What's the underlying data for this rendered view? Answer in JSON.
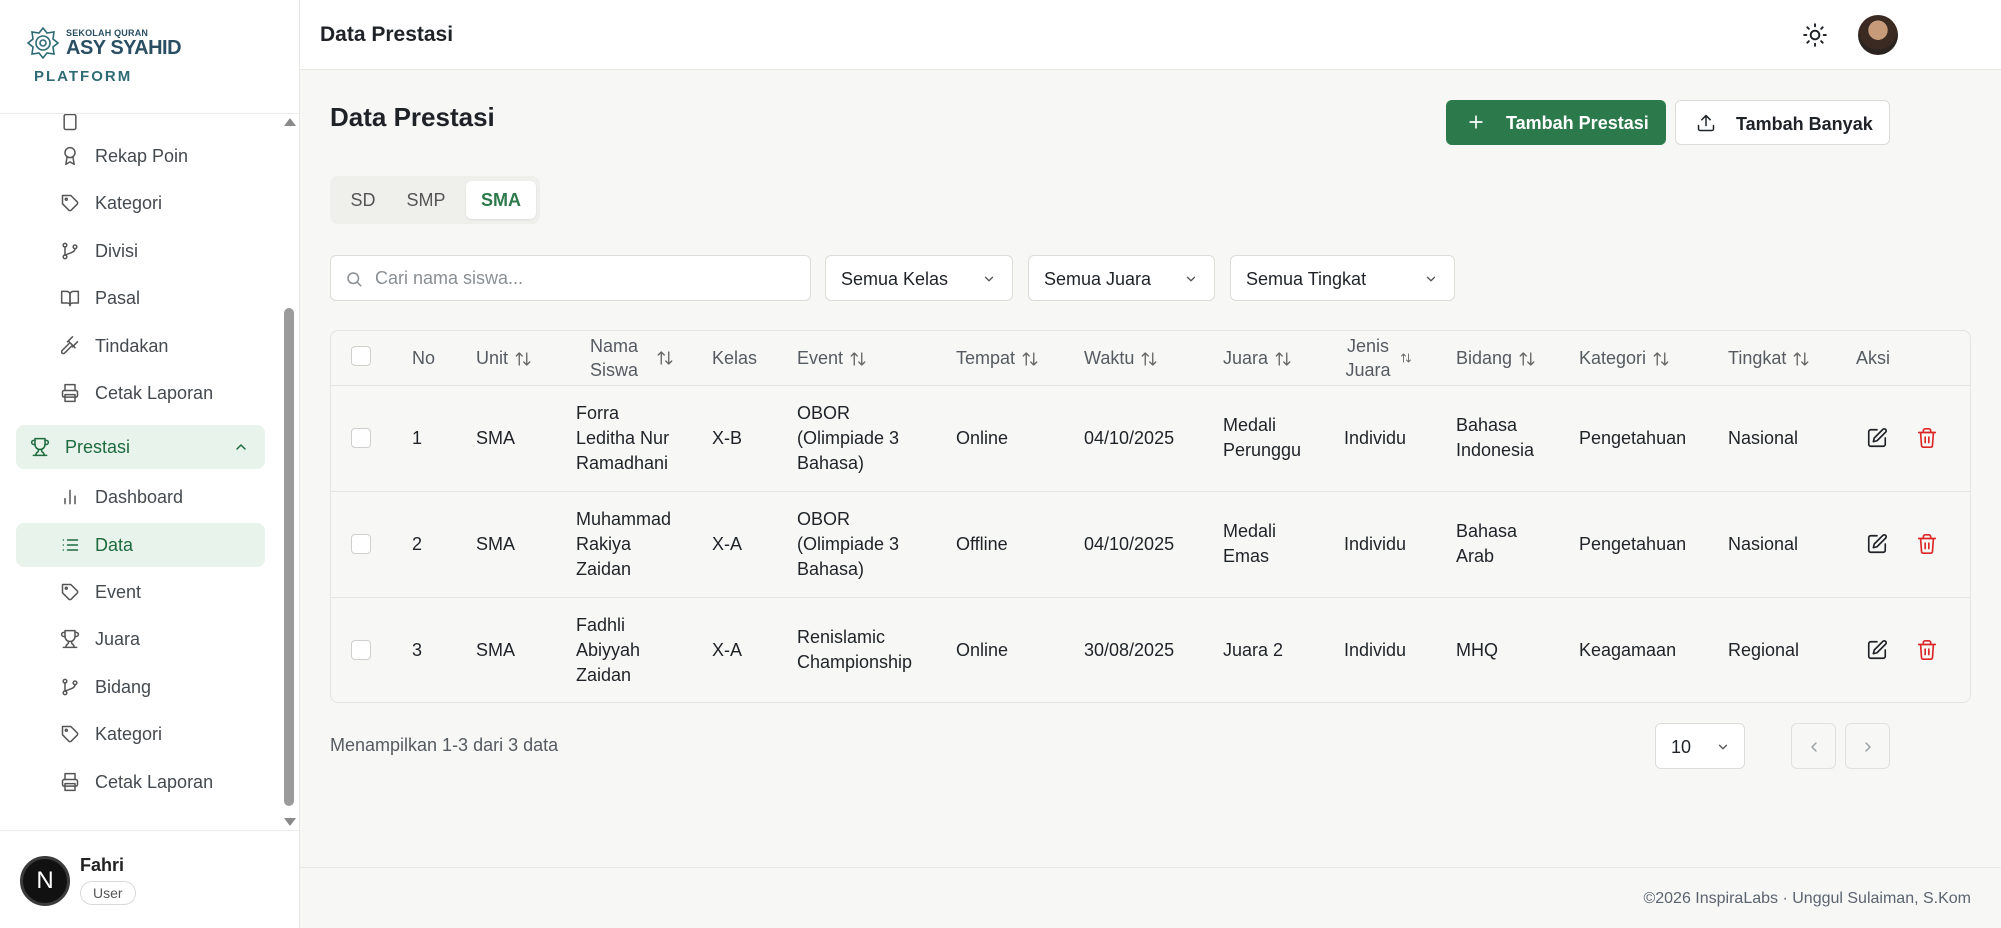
{
  "sidebar": {
    "logo": {
      "small": "SEKOLAH QURAN",
      "big": "ASY SYAHID",
      "sub": "PLATFORM"
    },
    "items_top": [
      {
        "label": "Rekap Poin",
        "icon": "award-icon"
      },
      {
        "label": "Kategori",
        "icon": "tag-icon"
      },
      {
        "label": "Divisi",
        "icon": "git-branch-icon"
      },
      {
        "label": "Pasal",
        "icon": "book-open-icon"
      },
      {
        "label": "Tindakan",
        "icon": "gavel-icon"
      },
      {
        "label": "Cetak Laporan",
        "icon": "printer-icon"
      }
    ],
    "group": {
      "label": "Prestasi",
      "icon": "trophy-icon"
    },
    "items_group": [
      {
        "label": "Dashboard",
        "icon": "bar-chart-icon"
      },
      {
        "label": "Data",
        "icon": "list-icon",
        "active": true
      },
      {
        "label": "Event",
        "icon": "tag-icon"
      },
      {
        "label": "Juara",
        "icon": "trophy-icon"
      },
      {
        "label": "Bidang",
        "icon": "git-branch-icon"
      },
      {
        "label": "Kategori",
        "icon": "tag-icon"
      },
      {
        "label": "Cetak Laporan",
        "icon": "printer-icon"
      }
    ],
    "user": {
      "initial": "N",
      "name": "Fahri",
      "role": "User"
    }
  },
  "header": {
    "title": "Data Prestasi"
  },
  "main": {
    "title": "Data Prestasi",
    "add_button": "Tambah Prestasi",
    "bulk_button": "Tambah Banyak",
    "tabs": [
      {
        "label": "SD"
      },
      {
        "label": "SMP"
      },
      {
        "label": "SMA",
        "active": true
      }
    ],
    "search": {
      "placeholder": "Cari nama siswa...",
      "value": ""
    },
    "filters": {
      "kelas": "Semua Kelas",
      "juara": "Semua Juara",
      "tingkat": "Semua Tingkat"
    },
    "table": {
      "columns": [
        "No",
        "Unit",
        "Nama Siswa",
        "Kelas",
        "Event",
        "Tempat",
        "Waktu",
        "Juara",
        "Jenis Juara",
        "Bidang",
        "Kategori",
        "Tingkat",
        "Aksi"
      ],
      "rows": [
        {
          "no": "1",
          "unit": "SMA",
          "nama": [
            "Forra",
            "Leditha Nur",
            "Ramadhani"
          ],
          "kelas": "X-B",
          "event": [
            "OBOR",
            "(Olimpiade 3",
            "Bahasa)"
          ],
          "tempat": "Online",
          "waktu": "04/10/2025",
          "juara": [
            "Medali",
            "Perunggu"
          ],
          "jenis": "Individu",
          "bidang": [
            "Bahasa",
            "Indonesia"
          ],
          "kategori": "Pengetahuan",
          "tingkat": "Nasional"
        },
        {
          "no": "2",
          "unit": "SMA",
          "nama": [
            "Muhammad",
            "Rakiya",
            "Zaidan"
          ],
          "kelas": "X-A",
          "event": [
            "OBOR",
            "(Olimpiade 3",
            "Bahasa)"
          ],
          "tempat": "Offline",
          "waktu": "04/10/2025",
          "juara": [
            "Medali",
            "Emas"
          ],
          "jenis": "Individu",
          "bidang": [
            "Bahasa",
            "Arab"
          ],
          "kategori": "Pengetahuan",
          "tingkat": "Nasional"
        },
        {
          "no": "3",
          "unit": "SMA",
          "nama": [
            "Fadhli",
            "Abiyyah",
            "Zaidan"
          ],
          "kelas": "X-A",
          "event": [
            "Renislamic",
            "Championship"
          ],
          "tempat": "Online",
          "waktu": "30/08/2025",
          "juara": [
            "Juara 2"
          ],
          "jenis": "Individu",
          "bidang": [
            "MHQ"
          ],
          "kategori": "Keagamaan",
          "tingkat": "Regional"
        }
      ]
    },
    "pagination": {
      "info": "Menampilkan 1-3 dari 3 data",
      "page_size": "10"
    }
  },
  "footer": {
    "text": "©2026 InspiraLabs · Unggul Sulaiman, S.Kom"
  },
  "colors": {
    "primary": "#2c7a4b",
    "active_bg": "#e8f3ec",
    "delete": "#dc2626"
  }
}
